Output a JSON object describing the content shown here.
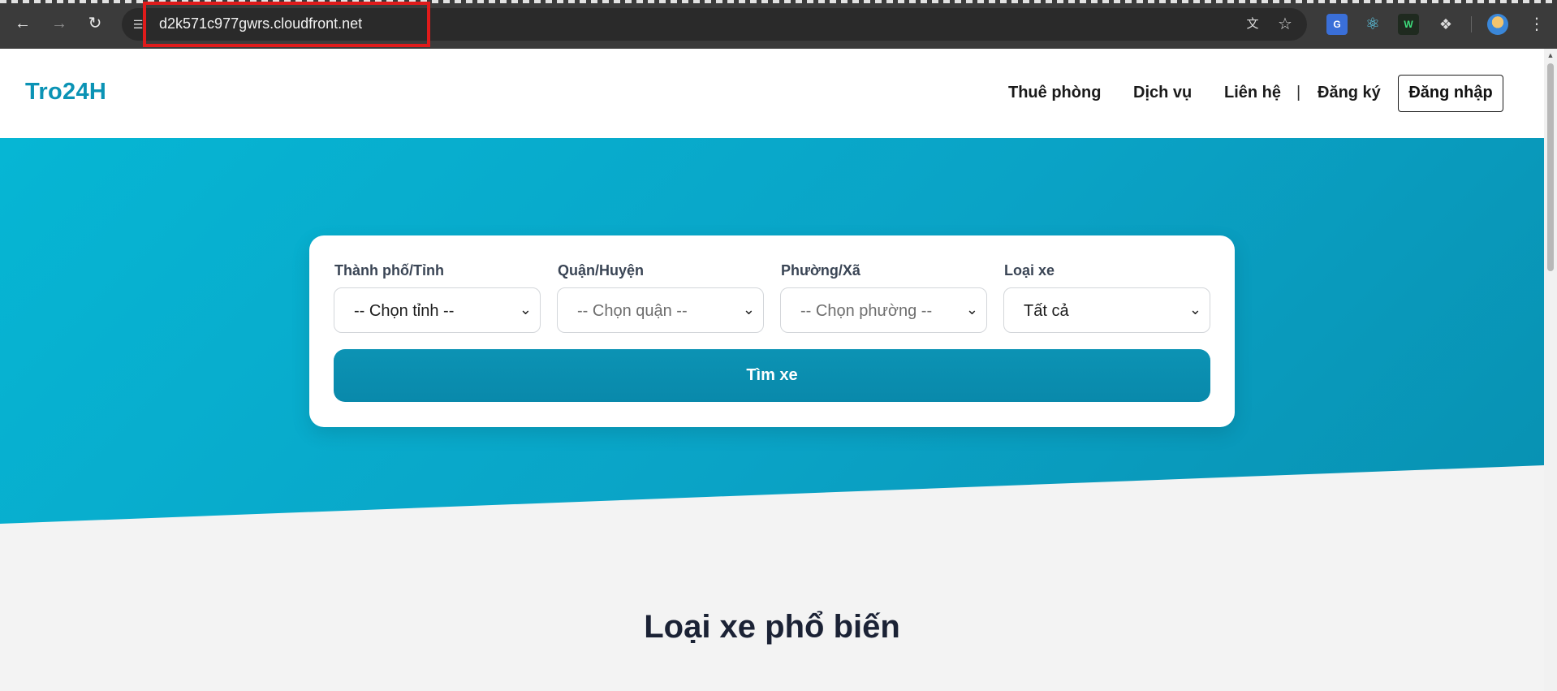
{
  "browser": {
    "url": "d2k571c977gwrs.cloudfront.net",
    "icons": [
      "back-icon",
      "forward-icon",
      "reload-icon",
      "site-info-icon",
      "translate-icon",
      "star-icon",
      "google-translate-extension-icon",
      "react-devtools-icon",
      "wappalyzer-icon",
      "extensions-puzzle-icon",
      "profile-avatar",
      "more-menu-icon"
    ]
  },
  "header": {
    "logo": "Tro24H",
    "nav": [
      {
        "label": "Thuê phòng"
      },
      {
        "label": "Dịch vụ"
      },
      {
        "label": "Liên hệ"
      }
    ],
    "separator": "|",
    "register": "Đăng ký",
    "login": "Đăng nhập"
  },
  "search": {
    "fields": [
      {
        "label": "Thành phố/Tỉnh",
        "value": "-- Chọn tỉnh --"
      },
      {
        "label": "Quận/Huyện",
        "value": "-- Chọn quận --"
      },
      {
        "label": "Phường/Xã",
        "value": "-- Chọn phường --"
      },
      {
        "label": "Loại xe",
        "value": "Tất cả"
      }
    ],
    "button": "Tìm xe"
  },
  "sections": {
    "popular_title": "Loại xe phổ biến"
  },
  "colors": {
    "brand": "#0b93b5",
    "hero_start": "#06b6d4",
    "hero_end": "#0891b2",
    "button": "#0c93b4",
    "url_highlight": "#e01b1b"
  }
}
